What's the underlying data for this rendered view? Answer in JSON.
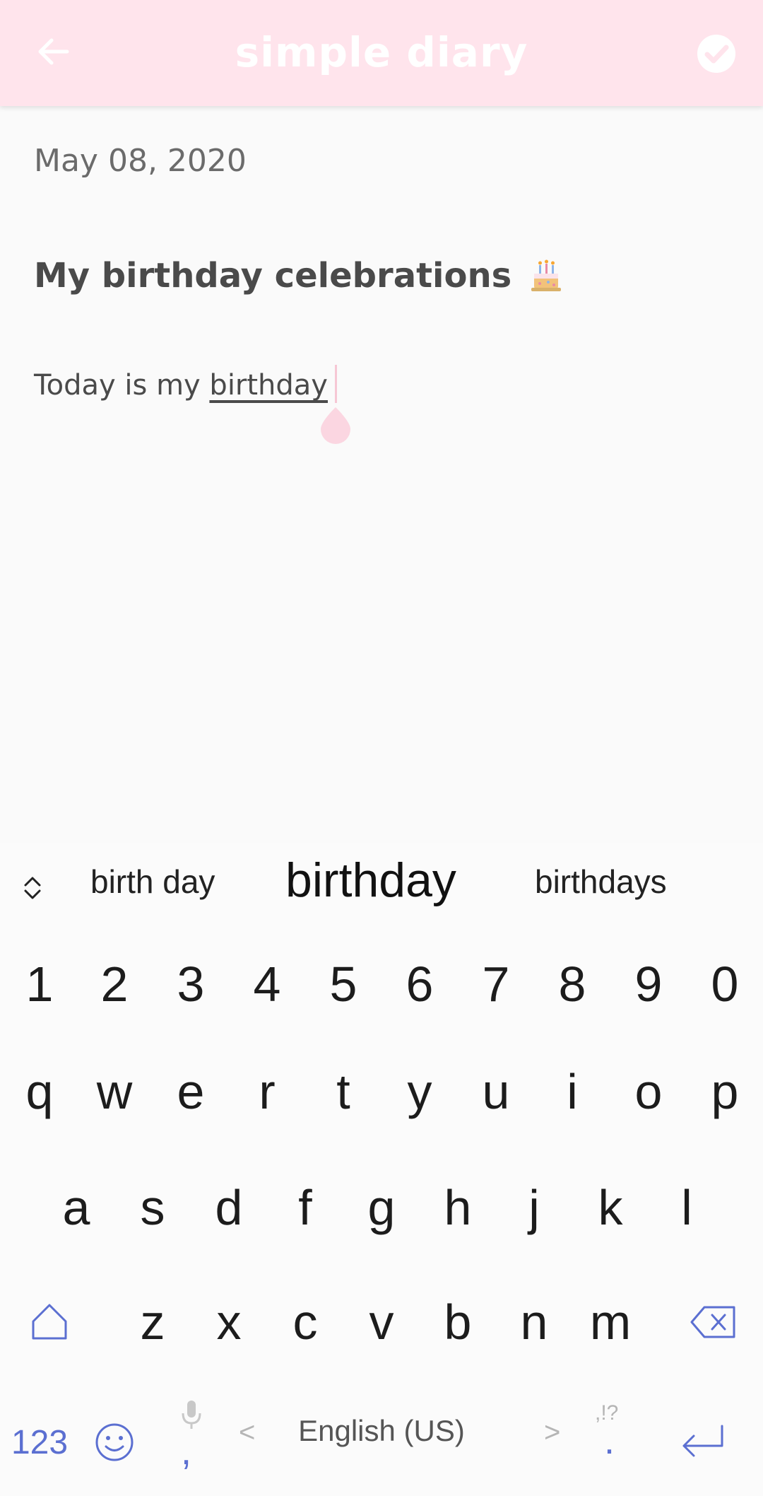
{
  "header": {
    "title": "simple diary",
    "back_icon": "arrow-left-icon",
    "save_icon": "check-circle-icon",
    "background": "#ffe4ec"
  },
  "entry": {
    "date": "May 08, 2020",
    "title": "My birthday celebrations",
    "title_icon": "birthday-cake-icon",
    "body_prefix": "Today is my ",
    "body_current_word": "birthday"
  },
  "keyboard": {
    "suggestions": [
      "birth day",
      "birthday",
      "birthdays"
    ],
    "numbers": [
      "1",
      "2",
      "3",
      "4",
      "5",
      "6",
      "7",
      "8",
      "9",
      "0"
    ],
    "row1": [
      "q",
      "w",
      "e",
      "r",
      "t",
      "y",
      "u",
      "i",
      "o",
      "p"
    ],
    "row2": [
      "a",
      "s",
      "d",
      "f",
      "g",
      "h",
      "j",
      "k",
      "l"
    ],
    "row3": [
      "z",
      "x",
      "c",
      "v",
      "b",
      "n",
      "m"
    ],
    "symbols_label": "123",
    "comma": ",",
    "period": ".",
    "period_hint": ",!?",
    "space_label": "English (US)",
    "space_left": "<",
    "space_right": ">",
    "accent_color": "#5b6fd1"
  }
}
